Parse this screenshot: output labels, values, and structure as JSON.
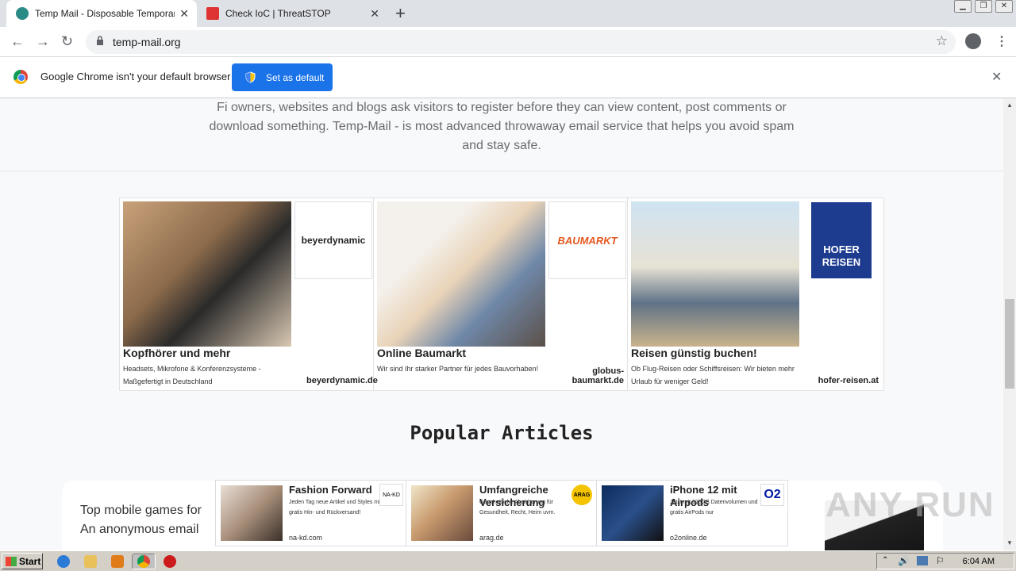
{
  "browser": {
    "tabs": [
      {
        "title": "Temp Mail - Disposable Temporary E",
        "active": true
      },
      {
        "title": "Check IoC | ThreatSTOP",
        "active": false
      }
    ],
    "new_tab_label": "+",
    "window_controls": [
      "minimize",
      "restore",
      "close"
    ],
    "url": "temp-mail.org"
  },
  "infobar": {
    "message": "Google Chrome isn't your default browser",
    "button_label": "Set as default"
  },
  "page": {
    "intro_text": "Fi owners, websites and blogs ask visitors to register before they can view content, post comments or download something. Temp-Mail - is most advanced throwaway email service that helps you avoid spam and stay safe.",
    "ads": [
      {
        "headline": "Kopfhörer und mehr",
        "description": "Headsets, Mikrofone & Konferenzsysteme - Maßgefertigt in Deutschland",
        "domain": "beyerdynamic.de",
        "logo_text": "beyerdynamic"
      },
      {
        "headline": "Online Baumarkt",
        "description": "Wir sind Ihr starker Partner für jedes Bauvorhaben!",
        "domain": "globus-baumarkt.de",
        "logo_text": "BAUMARKT"
      },
      {
        "headline": "Reisen günstig buchen!",
        "description": "Ob Flug-Reisen oder Schiffsreisen: Wir bieten mehr Urlaub für weniger Geld!",
        "domain": "hofer-reisen.at",
        "logo_text": "HOFER REISEN"
      }
    ],
    "popular_heading": "Popular Articles",
    "article_text": "Top mobile games for An anonymous email",
    "native_ads": [
      {
        "headline": "Fashion Forward",
        "description": "Jeden Tag neue Artikel und Styles mit gratis Hin- und Rückversand!",
        "domain": "na-kd.com",
        "logo_text": "NA-KD"
      },
      {
        "headline": "Umfangreiche Versicherung",
        "description": "Ganzheitliche Absicherung für Gesundheit, Recht, Heim uvm.",
        "domain": "arag.de",
        "logo_text": "ARAG"
      },
      {
        "headline": "iPhone 12 mit Airpods",
        "description": "Jetzt mit 120GB Datenvolumen und gratis AirPods nur",
        "domain": "o2online.de",
        "logo_text": "O2"
      }
    ],
    "watermark": "ANY RUN"
  },
  "taskbar": {
    "start_label": "Start",
    "clock": "6:04 AM"
  }
}
